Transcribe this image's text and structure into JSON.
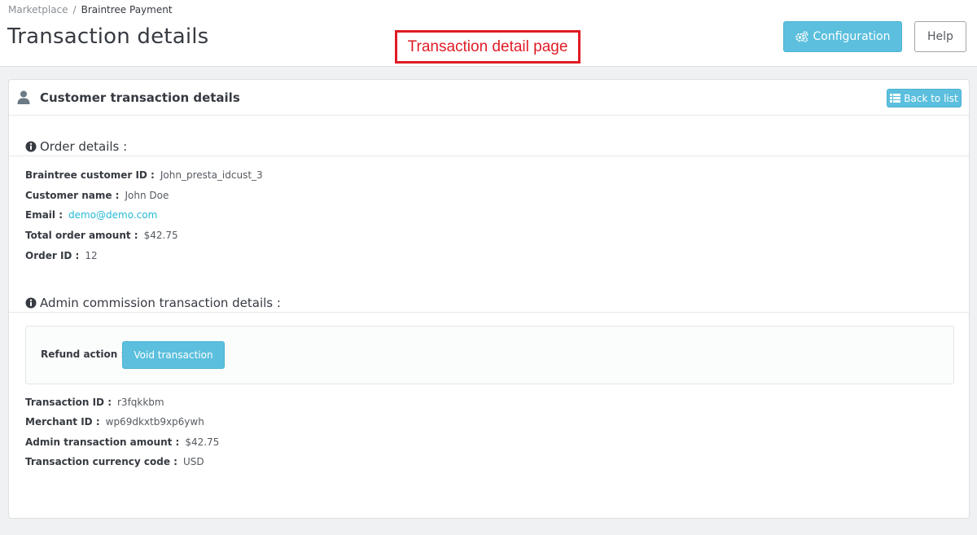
{
  "breadcrumb": {
    "parent": "Marketplace",
    "separator": "/",
    "current": "Braintree Payment"
  },
  "header": {
    "title": "Transaction details",
    "annotation": "Transaction detail page",
    "config_label": "Configuration",
    "help_label": "Help"
  },
  "panel": {
    "title": "Customer transaction details",
    "back_label": "Back to list"
  },
  "order": {
    "title": "Order details :",
    "fields": [
      {
        "label": "Braintree customer ID :",
        "value": "John_presta_idcust_3"
      },
      {
        "label": "Customer name :",
        "value": "John Doe"
      },
      {
        "label": "Email :",
        "value": "demo@demo.com"
      },
      {
        "label": "Total order amount :",
        "value": "$42.75"
      },
      {
        "label": "Order ID :",
        "value": "12"
      }
    ]
  },
  "admin": {
    "title": "Admin commission transaction details :",
    "refund_label": "Refund action :",
    "void_label": "Void transaction",
    "fields": [
      {
        "label": "Transaction ID :",
        "value": "r3fqkkbm"
      },
      {
        "label": "Merchant ID :",
        "value": "wp69dkxtb9xp6ywh"
      },
      {
        "label": "Admin transaction amount :",
        "value": "$42.75"
      },
      {
        "label": "Transaction currency code :",
        "value": "USD"
      }
    ]
  },
  "colors": {
    "accent": "#5bbfdd",
    "link": "#25b9d7",
    "annotation": "#e01b24"
  },
  "icons": {
    "config": "gears-icon",
    "back": "list-icon",
    "panel": "user-icon",
    "section": "info-circle-icon"
  }
}
